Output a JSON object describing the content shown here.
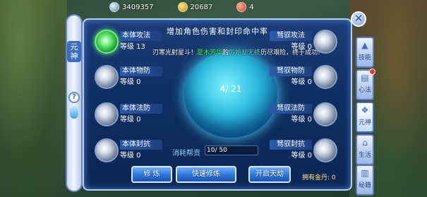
{
  "currencies": {
    "diamond": "3409357",
    "gold": "20687",
    "ingot": "4"
  },
  "side": {
    "title": "元神",
    "help": "?"
  },
  "panel": {
    "title": "增加角色伤害和封印命中率",
    "notice_prefix": "刃寒光射星斗！",
    "notice_name": "夏木芳华",
    "notice_mid": "的",
    "notice_phrase": "厉始却无终",
    "notice_suffix": "历尽艰险，终于成功!"
  },
  "orb": {
    "progress": "4/ 21"
  },
  "slots": [
    {
      "label": "本体攻法",
      "level": "等级 13"
    },
    {
      "label": "驽驭攻法",
      "level": "等级 0"
    },
    {
      "label": "本体物防",
      "level": "等级 0"
    },
    {
      "label": "驽驭物防",
      "level": "等级 0"
    },
    {
      "label": "本体法防",
      "level": "等级 0"
    },
    {
      "label": "驽驭法防",
      "level": "等级 0"
    },
    {
      "label": "本体封抗",
      "level": "等级 0"
    },
    {
      "label": "驽驭封抗",
      "level": "等级 0"
    }
  ],
  "cost": {
    "label": "消耗帮贡",
    "value": "10/ 50"
  },
  "buttons": {
    "train": "修 炼",
    "quick_train": "快速修炼",
    "heaven": "开启天劫"
  },
  "gold_owned": "拥有金丹: 0",
  "tabs": [
    {
      "label": "技能",
      "icon": "building-icon"
    },
    {
      "label": "心法",
      "icon": "scroll-icon"
    },
    {
      "label": "元神",
      "icon": "spirit-icon"
    },
    {
      "label": "生活",
      "icon": "house-icon"
    },
    {
      "label": "秘籍",
      "icon": "book-icon"
    }
  ],
  "close": "✕"
}
